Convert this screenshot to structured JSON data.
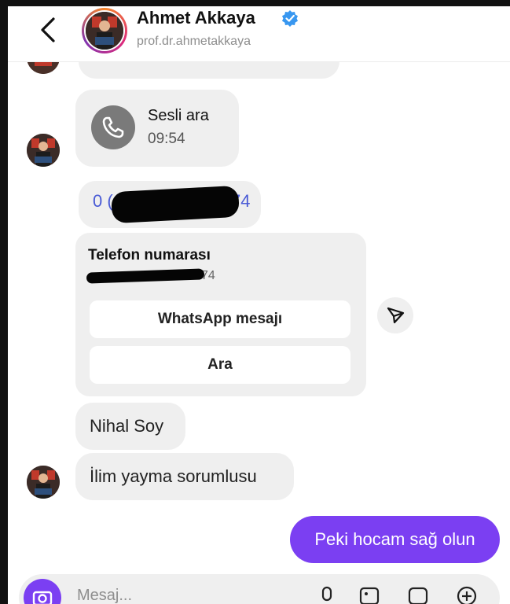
{
  "header": {
    "name": "Ahmet Akkaya",
    "username": "prof.dr.ahmetakkaya"
  },
  "messages": {
    "call": {
      "title": "Sesli ara",
      "time": "09:54"
    },
    "phone_visible_start": "0 (",
    "phone_visible_end": "74",
    "card": {
      "title": "Telefon numarası",
      "number_visible_end": "74",
      "whatsapp_label": "WhatsApp mesajı",
      "call_label": "Ara"
    },
    "text1": "Nihal Soy",
    "text2": "İlim yayma sorumlusu",
    "sent": "Peki hocam sağ olun"
  },
  "composer": {
    "placeholder": "Mesaj..."
  },
  "colors": {
    "accent": "#7b3ff2",
    "link": "#4a5bd6",
    "bubble": "#efefef",
    "verified": "#3897f0"
  }
}
